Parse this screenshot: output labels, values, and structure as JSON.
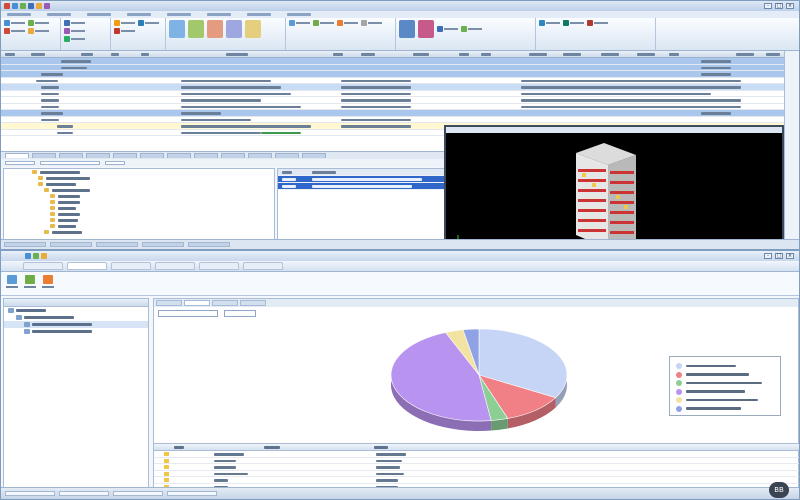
{
  "top_window": {
    "title": "",
    "toolbar_label": "",
    "status_label": ""
  },
  "bottom_window": {
    "title": "",
    "tabs": [
      "",
      "",
      "",
      "",
      "",
      ""
    ],
    "status_label": ""
  },
  "chart_data": {
    "type": "pie",
    "title": "",
    "labels": [],
    "values": [
      33.2,
      11.5,
      3.1,
      46.0,
      3.3,
      2.9
    ],
    "colors": [
      "#c6d4f5",
      "#f07f86",
      "#8ccf95",
      "#b993f0",
      "#f3e3a2",
      "#8fa2e6"
    ],
    "legend_position": "right"
  },
  "badge": {
    "text": "BB"
  }
}
